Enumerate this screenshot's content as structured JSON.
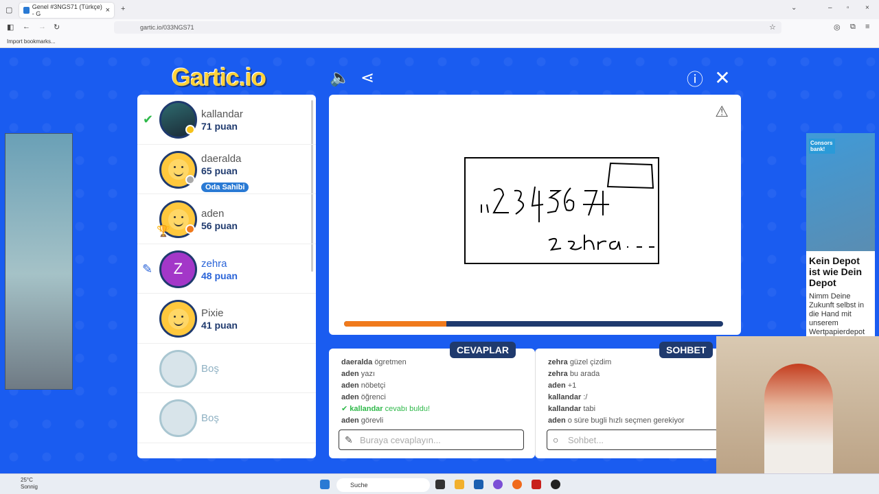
{
  "browser": {
    "tab_title": "Genel #3NGS71 (Türkçe) - G",
    "url": "gartic.io/033NGS71",
    "bookmark": "Import bookmarks..."
  },
  "game": {
    "logo": "Gartic.io",
    "players": [
      {
        "name": "kallandar",
        "score": "71 puan",
        "status": "guessed"
      },
      {
        "name": "daeralda",
        "score": "65 puan",
        "badge": "Oda Sahibi"
      },
      {
        "name": "aden",
        "score": "56 puan"
      },
      {
        "name": "zehra",
        "score": "48 puan",
        "status": "drawing",
        "initial": "Z"
      },
      {
        "name": "Pixie",
        "score": "41 puan"
      },
      {
        "name": "Boş",
        "score": ""
      },
      {
        "name": "Boş",
        "score": ""
      }
    ],
    "progress": 0.27,
    "answers_title": "CEVAPLAR",
    "chat_title": "SOHBET",
    "answers": [
      {
        "user": "daeralda",
        "text": "ögretmen"
      },
      {
        "user": "aden",
        "text": "yazı"
      },
      {
        "user": "aden",
        "text": "nöbetçi"
      },
      {
        "user": "aden",
        "text": "öğrenci"
      },
      {
        "user": "kallandar",
        "text": "cevabı buldu!",
        "found": true
      },
      {
        "user": "aden",
        "text": "görevli"
      }
    ],
    "chat": [
      {
        "user": "zehra",
        "text": "güzel çizdim"
      },
      {
        "user": "zehra",
        "text": "bu arada"
      },
      {
        "user": "aden",
        "text": "+1"
      },
      {
        "user": "kallandar",
        "text": ":/"
      },
      {
        "user": "kallandar",
        "text": "tabi"
      },
      {
        "user": "aden",
        "text": "o süre bugli hızlı seçmen gerekiyor"
      }
    ],
    "answer_placeholder": "Buraya cevaplayın...",
    "chat_placeholder": "Sohbet..."
  },
  "ad_right": {
    "brand": "Consors bank!",
    "headline": "Kein Depot ist wie Dein Depot",
    "body": "Nimm Deine Zukunft selbst in die Hand mit unserem Wertpapierdepot"
  },
  "taskbar": {
    "temp": "25°C",
    "weather": "Sonnig",
    "search": "Suche"
  }
}
